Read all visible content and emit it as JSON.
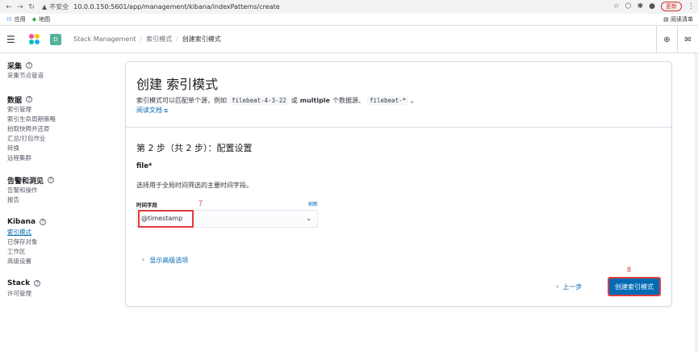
{
  "browser": {
    "url": "10.0.0.150:5601/app/management/kibana/indexPatterns/create",
    "insecure_label": "不安全",
    "update_label": "更新",
    "bookmarks": [
      {
        "label": "应用",
        "icon": "apps-grid-icon"
      },
      {
        "label": "地图",
        "icon": "maps-icon"
      }
    ],
    "reading_list_label": "阅读清单"
  },
  "header": {
    "space_initial": "D",
    "breadcrumbs": [
      "Stack Management",
      "索引模式",
      "创建索引模式"
    ]
  },
  "sidebar": {
    "groups": [
      {
        "title": "采集",
        "items": [
          "采集节点管道"
        ]
      },
      {
        "title": "数据",
        "items": [
          "索引管理",
          "索引生命周期策略",
          "拍取快照并还原",
          "汇总/打包作业",
          "转换",
          "远程集群"
        ]
      },
      {
        "title": "告警和洞见",
        "items": [
          "告警和操作",
          "报告"
        ]
      },
      {
        "title": "Kibana",
        "items": [
          "索引模式",
          "已保存对象",
          "工作区",
          "高级设置"
        ]
      },
      {
        "title": "Stack",
        "items": [
          "许可管理"
        ]
      }
    ],
    "active_item": "索引模式"
  },
  "panel": {
    "title": "创建 索引模式",
    "desc_prefix": "索引模式可以匹配单个源，例如",
    "desc_code1": "filebeat-4-3-22",
    "desc_or": "或",
    "desc_bold": "multiple",
    "desc_mid": "个数据源、",
    "desc_code2": "filebeat-*",
    "desc_end": "。",
    "doc_link": "阅读文档",
    "step_title": "第 2 步（共 2 步）：配置设置",
    "index_name": "file*",
    "field_desc": "选择用于全局时间筛选的主要时间字段。",
    "field_label": "时间字段",
    "refresh_label": "刷新",
    "time_field_value": "@timestamp",
    "advanced_toggle": "显示高级选项",
    "back_label": "上一步",
    "create_label": "创建索引模式"
  },
  "annotations": {
    "step7": "7",
    "step8": "8"
  },
  "colors": {
    "primary": "#006bb4",
    "annotation": "#e03b3b",
    "space_badge": "#54b399"
  }
}
